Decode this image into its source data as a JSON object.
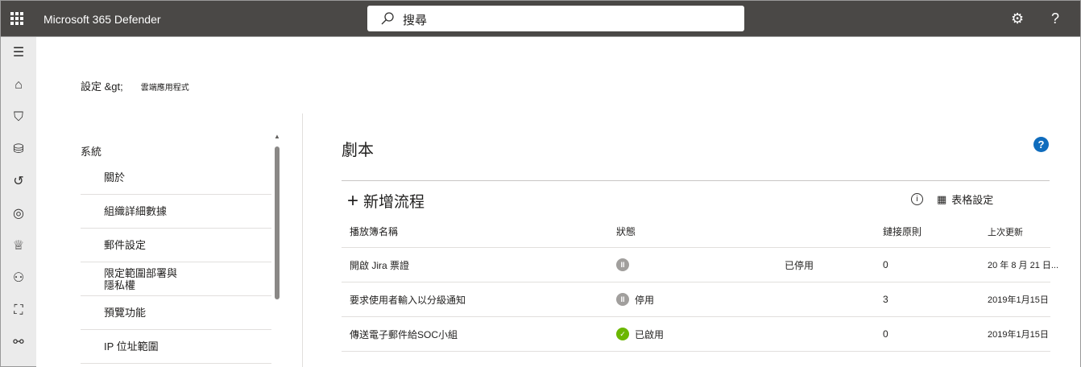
{
  "header": {
    "app_title": "Microsoft 365 Defender",
    "search_placeholder": "搜尋"
  },
  "breadcrumb": {
    "root": "設定 &gt;",
    "current": "雲端應用程式"
  },
  "nav": {
    "section": "系統",
    "items": [
      {
        "label": "關於"
      },
      {
        "label": "組織詳細數據"
      },
      {
        "label": "郵件設定"
      },
      {
        "label": "限定範圍部署與隱私權"
      },
      {
        "label": "預覽功能"
      },
      {
        "label": "IP 位址範圍"
      }
    ]
  },
  "main": {
    "title": "劇本",
    "add_label": "新增流程",
    "table_settings": "表格設定",
    "columns": [
      "播放簿名稱",
      "狀態",
      "",
      "鏈接原則",
      "上次更新"
    ],
    "rows": [
      {
        "name": "開啟 Jira 票證",
        "status": "",
        "status_extra": "已停用",
        "status_type": "paused",
        "policies": "0",
        "updated": "20 年 8 月 21 日..."
      },
      {
        "name": "要求使用者輸入以分級通知",
        "status": "停用",
        "status_extra": "",
        "status_type": "paused",
        "policies": "3",
        "updated": "2019年1月15日"
      },
      {
        "name": "傳送電子郵件給SOC小組",
        "status": "已啟用",
        "status_extra": "",
        "status_type": "enabled",
        "policies": "0",
        "updated": "2019年1月15日"
      }
    ]
  }
}
